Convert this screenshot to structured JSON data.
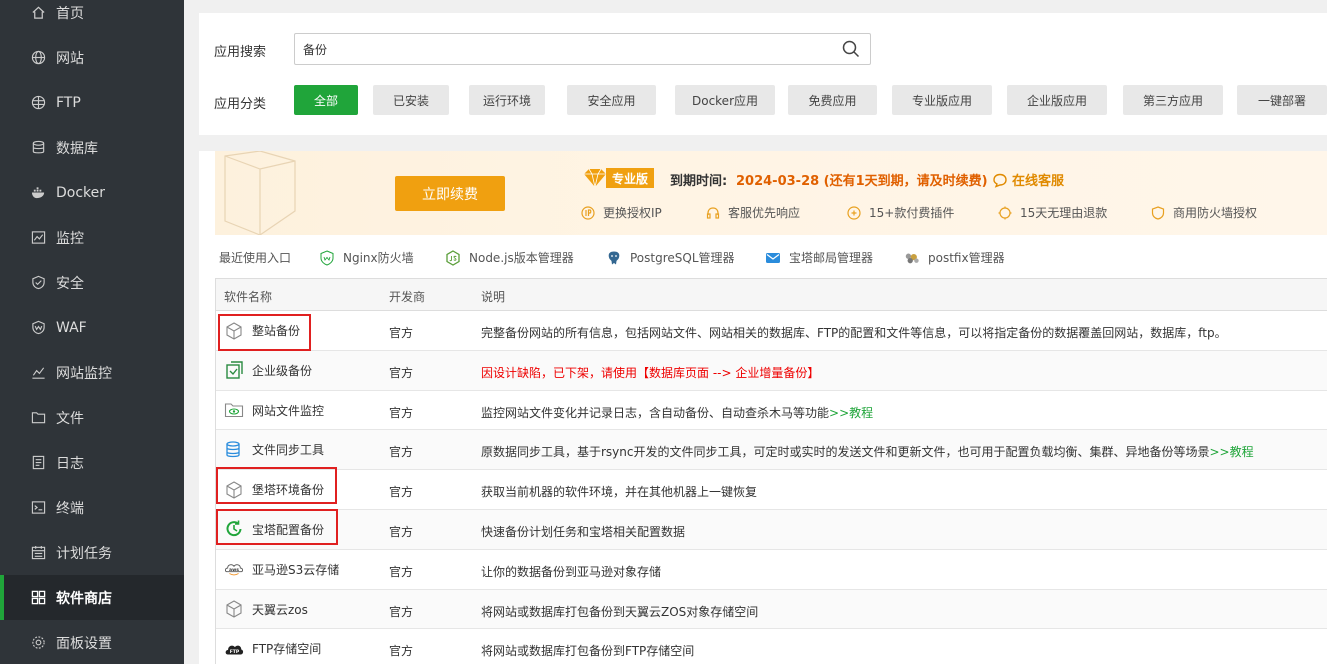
{
  "sidebar": {
    "items": [
      {
        "label": "首页",
        "icon": "home-icon"
      },
      {
        "label": "网站",
        "icon": "globe-icon"
      },
      {
        "label": "FTP",
        "icon": "ftp-globe-icon"
      },
      {
        "label": "数据库",
        "icon": "database-icon"
      },
      {
        "label": "Docker",
        "icon": "docker-icon"
      },
      {
        "label": "监控",
        "icon": "monitor-chart-icon"
      },
      {
        "label": "安全",
        "icon": "shield-check-icon"
      },
      {
        "label": "WAF",
        "icon": "waf-shield-icon"
      },
      {
        "label": "网站监控",
        "icon": "line-chart-icon"
      },
      {
        "label": "文件",
        "icon": "folder-icon"
      },
      {
        "label": "日志",
        "icon": "log-icon"
      },
      {
        "label": "终端",
        "icon": "terminal-icon"
      },
      {
        "label": "计划任务",
        "icon": "calendar-icon"
      },
      {
        "label": "软件商店",
        "icon": "grid-apps-icon",
        "active": true
      },
      {
        "label": "面板设置",
        "icon": "gear-icon"
      }
    ]
  },
  "search": {
    "label": "应用搜索",
    "value": "备份"
  },
  "categories": {
    "label": "应用分类",
    "items": [
      "全部",
      "已安装",
      "运行环境",
      "安全应用",
      "Docker应用",
      "免费应用",
      "专业版应用",
      "企业版应用",
      "第三方应用",
      "一键部署"
    ]
  },
  "promo": {
    "renew_button": "立即续费",
    "badge": "专业版",
    "expire_label": "到期时间:",
    "expire_value": "2024-03-28 (还有1天到期，请及时续费)",
    "online_service": "在线客服",
    "features": [
      "更换授权IP",
      "客服优先响应",
      "15+款付费插件",
      "15天无理由退款",
      "商用防火墙授权"
    ]
  },
  "recent": {
    "label": "最近使用入口",
    "items": [
      "Nginx防火墙",
      "Node.js版本管理器",
      "PostgreSQL管理器",
      "宝塔邮局管理器",
      "postfix管理器"
    ]
  },
  "table": {
    "headers": [
      "软件名称",
      "开发商",
      "说明"
    ],
    "rows": [
      {
        "name": "整站备份",
        "dev": "官方",
        "desc": "完整备份网站的所有信息，包括网站文件、网站相关的数据库、FTP的配置和文件等信息，可以将指定备份的数据覆盖回网站，数据库，ftp。",
        "icon": "box-icon"
      },
      {
        "name": "企业级备份",
        "dev": "官方",
        "desc": "因设计缺陷，已下架，请使用【数据库页面 --> 企业增量备份】",
        "icon": "enterprise-backup-icon"
      },
      {
        "name": "网站文件监控",
        "dev": "官方",
        "desc": "监控网站文件变化并记录日志，含自动备份、自动查杀木马等功能",
        "tutorial": ">>教程",
        "icon": "folder-eye-icon"
      },
      {
        "name": "文件同步工具",
        "dev": "官方",
        "desc": "原数据同步工具，基于rsync开发的文件同步工具，可定时或实时的发送文件和更新文件，也可用于配置负载均衡、集群、异地备份等场景",
        "tutorial": ">>教程",
        "icon": "sync-database-icon"
      },
      {
        "name": "堡塔环境备份",
        "dev": "官方",
        "desc": "获取当前机器的软件环境，并在其他机器上一键恢复",
        "icon": "box-icon"
      },
      {
        "name": "宝塔配置备份",
        "dev": "官方",
        "desc": "快速备份计划任务和宝塔相关配置数据",
        "icon": "clock-refresh-icon"
      },
      {
        "name": "亚马逊S3云存储",
        "dev": "官方",
        "desc": "让你的数据备份到亚马逊对象存储",
        "icon": "aws-icon"
      },
      {
        "name": "天翼云zos",
        "dev": "官方",
        "desc": "将网站或数据库打包备份到天翼云ZOS对象存储空间",
        "icon": "box-icon"
      },
      {
        "name": "FTP存储空间",
        "dev": "官方",
        "desc": "将网站或数据库打包备份到FTP存储空间",
        "icon": "ftp-cloud-icon"
      }
    ]
  },
  "colors": {
    "accent": "#20a53a",
    "sidebar": "#2f3439",
    "warning": "#e00000",
    "gold": "#f0a010"
  }
}
